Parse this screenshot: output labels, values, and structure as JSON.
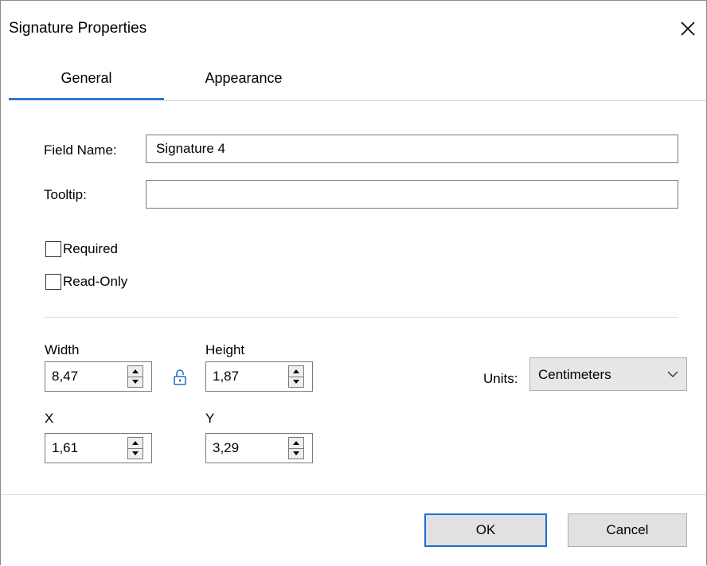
{
  "dialog": {
    "title": "Signature Properties",
    "close_icon": "close-icon"
  },
  "tabs": [
    {
      "label": "General",
      "active": true
    },
    {
      "label": "Appearance",
      "active": false
    }
  ],
  "general": {
    "field_name_label": "Field Name:",
    "field_name_value": "Signature 4",
    "tooltip_label": "Tooltip:",
    "tooltip_value": "",
    "required_label": "Required",
    "required_checked": false,
    "readonly_label": "Read-Only",
    "readonly_checked": false
  },
  "dimensions": {
    "width_label": "Width",
    "width_value": "8,47",
    "height_label": "Height",
    "height_value": "1,87",
    "x_label": "X",
    "x_value": "1,61",
    "y_label": "Y",
    "y_value": "3,29",
    "lock_icon": "lock-icon",
    "units_label": "Units:",
    "units_value": "Centimeters"
  },
  "footer": {
    "ok_label": "OK",
    "cancel_label": "Cancel"
  },
  "colors": {
    "accent": "#2b7ad0",
    "button_face": "#e1e1e1",
    "divider": "#d4dce8"
  }
}
